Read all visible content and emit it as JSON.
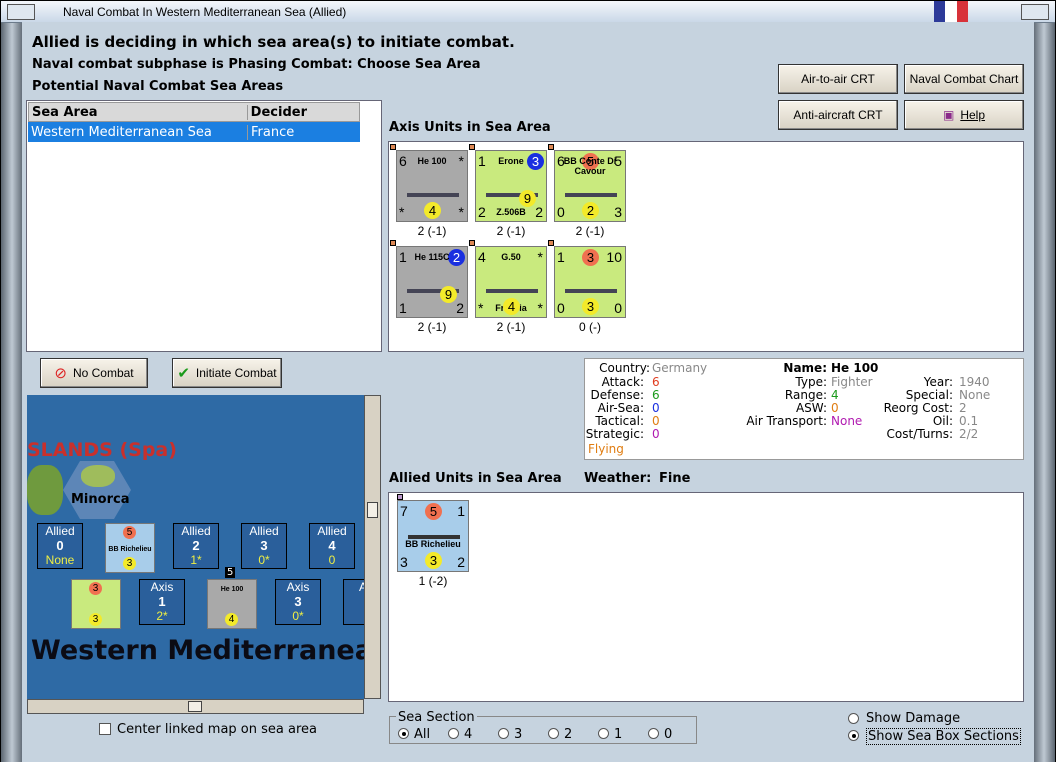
{
  "window": {
    "title": "Naval Combat In Western Mediterranean Sea (Allied)"
  },
  "header": {
    "line1": "Allied is deciding in which sea area(s) to initiate combat.",
    "line2": "Naval combat subphase is Phasing Combat: Choose Sea Area",
    "line3": "Potential Naval Combat Sea Areas"
  },
  "buttons": {
    "air_to_air": "Air-to-air CRT",
    "naval_chart": "Naval Combat Chart",
    "anti_aircraft": "Anti-aircraft CRT",
    "help": "Help",
    "no_combat": "No Combat",
    "initiate": "Initiate Combat"
  },
  "table": {
    "headers": [
      "Sea Area",
      "Decider"
    ],
    "rows": [
      {
        "area": "Western Mediterranean Sea",
        "decider": "France"
      }
    ]
  },
  "axis": {
    "title": "Axis Units in Sea Area",
    "units": [
      {
        "tl": "6",
        "tr": "*",
        "name": "He 100",
        "bl": "*",
        "br": "*",
        "circle": "4",
        "caption": "2 (-1)",
        "bg": "#a9a9a9"
      },
      {
        "tl": "1",
        "tr": "3",
        "name": "Erone",
        "sub": "Z.506B",
        "bl": "2",
        "br": "2",
        "circle": "9",
        "caption": "2 (-1)",
        "bg": "#c9ea7e"
      },
      {
        "tl": "6",
        "tr": "5",
        "topc": "5",
        "name": "BB Conte Di Cavour",
        "bl": "0",
        "br": "3",
        "circle": "2",
        "caption": "2 (-1)",
        "bg": "#c9ea7e"
      },
      {
        "tl": "1",
        "tr": "2",
        "name": "He 115C",
        "bl": "1",
        "br": "2",
        "circle": "9",
        "caption": "2 (-1)",
        "bg": "#a9a9a9"
      },
      {
        "tl": "4",
        "tr": "*",
        "name": "G.50",
        "sub": "Freccia",
        "bl": "*",
        "br": "*",
        "circle": "4",
        "caption": "2 (-1)",
        "bg": "#c9ea7e"
      },
      {
        "tl": "1",
        "tr": "10",
        "topc": "3",
        "name": "",
        "bl": "0",
        "br": "0",
        "circle": "3",
        "caption": "0 (-)",
        "bg": "#c9ea7e"
      }
    ]
  },
  "info": {
    "country_l": "Country:",
    "country": "Germany",
    "attack_l": "Attack:",
    "attack": "6",
    "defense_l": "Defense:",
    "defense": "6",
    "airsea_l": "Air-Sea:",
    "airsea": "0",
    "tactical_l": "Tactical:",
    "tactical": "0",
    "strategic_l": "Strategic:",
    "strategic": "0",
    "flying": "Flying",
    "name_l": "Name:",
    "name": "He 100",
    "type_l": "Type:",
    "type": "Fighter",
    "range_l": "Range:",
    "range": "4",
    "asw_l": "ASW:",
    "asw": "0",
    "airtrans_l": "Air Transport:",
    "airtrans": "None",
    "year_l": "Year:",
    "year": "1940",
    "special_l": "Special:",
    "special": "None",
    "reorg_l": "Reorg Cost:",
    "reorg": "2",
    "oil_l": "Oil:",
    "oil": "0.1",
    "cost_l": "Cost/Turns:",
    "cost": "2/2"
  },
  "allied": {
    "title": "Allied Units in Sea Area",
    "weather_l": "Weather:",
    "weather": "Fine",
    "unit": {
      "tl": "7",
      "topc": "5",
      "tr": "1",
      "name": "BB Richelieu",
      "bl": "3",
      "circle": "3",
      "br": "2",
      "caption": "1 (-2)"
    }
  },
  "map": {
    "islands": "SLANDS (Spa)",
    "minorca": "Minorca",
    "sea": "Western Mediterranea",
    "allied_boxes": [
      {
        "t": "Allied",
        "n": "0",
        "v": "None"
      },
      {
        "t": "Allied",
        "n": "2",
        "v": "1*"
      },
      {
        "t": "Allied",
        "n": "3",
        "v": "0*"
      },
      {
        "t": "Allied",
        "n": "4",
        "v": "0"
      }
    ],
    "axis_boxes": [
      {
        "t": "Axis",
        "n": "1",
        "v": "2*"
      },
      {
        "t": "Axis",
        "n": "3",
        "v": "0*"
      },
      {
        "t": "Ax",
        "n": "",
        "v": ""
      }
    ],
    "stack": "5",
    "center_label": "Center linked map on sea area"
  },
  "sea_section": {
    "label": "Sea Section",
    "options": [
      "All",
      "4",
      "3",
      "2",
      "1",
      "0"
    ],
    "selected": "All"
  },
  "options": {
    "show_damage": "Show Damage",
    "show_sections": "Show Sea Box Sections"
  },
  "colors": {
    "red": "#e03c1f",
    "green": "#1a9a1a",
    "blue": "#1a2fe0",
    "orange": "#e07d12",
    "purple": "#b01ab0",
    "gray": "#888888"
  }
}
